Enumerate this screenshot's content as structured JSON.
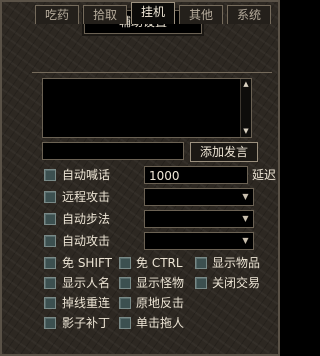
{
  "window": {
    "title": "辅助设置",
    "close_glyph": "×"
  },
  "tabs": [
    {
      "label": "吃药",
      "active": false
    },
    {
      "label": "拾取",
      "active": false
    },
    {
      "label": "挂机",
      "active": true
    },
    {
      "label": "其他",
      "active": false
    },
    {
      "label": "系统",
      "active": false
    }
  ],
  "shout": {
    "add_button": "添加发言",
    "input_value": ""
  },
  "options": {
    "auto_shout": {
      "label": "自动喊话",
      "value": "1000",
      "unit": "延迟"
    },
    "ranged_attack": {
      "label": "远程攻击",
      "selected": ""
    },
    "auto_step": {
      "label": "自动步法",
      "selected": ""
    },
    "auto_attack": {
      "label": "自动攻击",
      "selected": ""
    }
  },
  "toggles": {
    "no_shift": "免 SHIFT",
    "no_ctrl": "免 CTRL",
    "show_items": "显示物品",
    "show_names": "显示人名",
    "show_monsters": "显示怪物",
    "close_trade": "关闭交易",
    "reconnect": "掉线重连",
    "counter_attack": "原地反击",
    "shadow_patch": "影子补丁",
    "single_click_pull": "单击拖人"
  },
  "icons": {
    "scroll_up": "▲",
    "scroll_down": "▼",
    "dropdown": "▼"
  }
}
